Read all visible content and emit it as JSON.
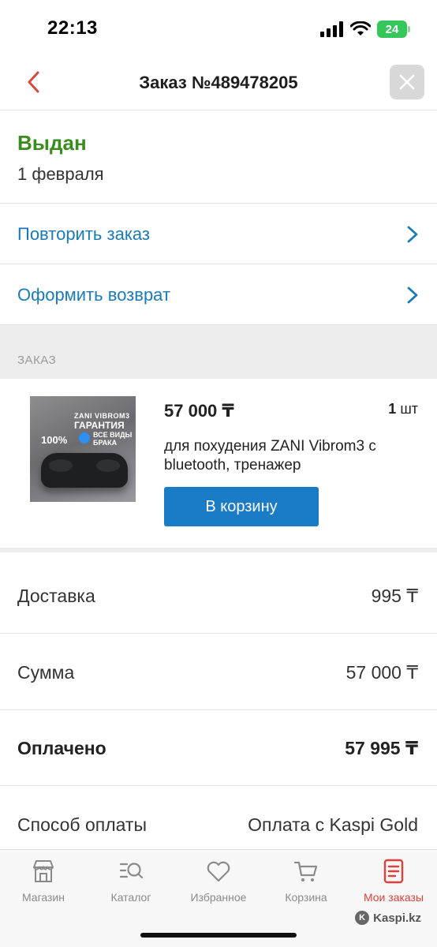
{
  "status_bar": {
    "time": "22:13",
    "battery": "24"
  },
  "nav": {
    "title": "Заказ №489478205"
  },
  "order": {
    "status": "Выдан",
    "date": "1 февраля"
  },
  "actions": [
    {
      "label": "Повторить заказ"
    },
    {
      "label": "Оформить возврат"
    }
  ],
  "section": {
    "header": "ЗАКАЗ"
  },
  "product": {
    "price": "57 000 ₸",
    "qty_number": "1",
    "qty_unit": "шт",
    "name": "для похудения ZANI Vibrom3 с bluetooth, тренажер",
    "cart_button": "В корзину",
    "image_text": {
      "brand": "ZANI VIBROM3",
      "guarantee": "ГАРАНТИЯ",
      "percent": "100%",
      "defects": "ВСЕ ВИДЫ БРАКА"
    }
  },
  "summary": [
    {
      "key": "Доставка",
      "value": "995 ₸"
    },
    {
      "key": "Сумма",
      "value": "57 000 ₸"
    },
    {
      "key": "Оплачено",
      "value": "57 995 ₸"
    },
    {
      "key": "Способ оплаты",
      "value": "Оплата с Kaspi Gold"
    }
  ],
  "tabs": [
    {
      "label": "Магазин",
      "icon": "store-icon"
    },
    {
      "label": "Каталог",
      "icon": "catalog-search-icon"
    },
    {
      "label": "Избранное",
      "icon": "heart-icon"
    },
    {
      "label": "Корзина",
      "icon": "cart-icon"
    },
    {
      "label": "Мои заказы",
      "icon": "orders-icon"
    }
  ],
  "watermark": "Kaspi.kz",
  "colors": {
    "accent_blue": "#1a7bc7",
    "link_blue": "#1a7bb8",
    "status_green": "#3a8c1f",
    "active_red": "#e0403a",
    "back_red": "#d9483b"
  }
}
